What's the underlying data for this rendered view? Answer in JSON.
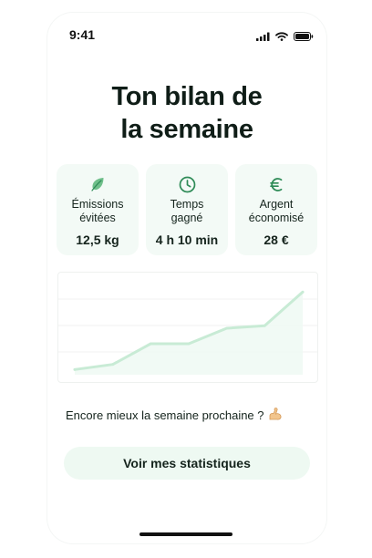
{
  "status_bar": {
    "time": "9:41"
  },
  "header": {
    "title_line1": "Ton bilan de",
    "title_line2": "la semaine"
  },
  "stats": [
    {
      "icon": "leaf-icon",
      "label": "Émissions\névitées",
      "value": "12,5 kg"
    },
    {
      "icon": "clock-icon",
      "label": "Temps\ngagné",
      "value": "4 h 10 min"
    },
    {
      "icon": "euro-icon",
      "label": "Argent\néconomisé",
      "value": "28 €"
    }
  ],
  "colors": {
    "accent": "#2e8b57",
    "card_bg": "#f3faf6",
    "line": "#c8ebd5",
    "area": "#eef9f2",
    "button_bg": "#eef9f2"
  },
  "chart_data": {
    "type": "area",
    "x": [
      1,
      2,
      3,
      4,
      5,
      6,
      7
    ],
    "series": [
      {
        "values": [
          1,
          2,
          6,
          6,
          9,
          9.5,
          16
        ]
      }
    ],
    "ylim": [
      0,
      18
    ],
    "grid": true,
    "title": "",
    "xlabel": "",
    "ylabel": ""
  },
  "prompt": {
    "text": "Encore mieux la semaine prochaine ?",
    "icon": "flexed-biceps-icon"
  },
  "cta": {
    "label": "Voir mes statistiques"
  }
}
